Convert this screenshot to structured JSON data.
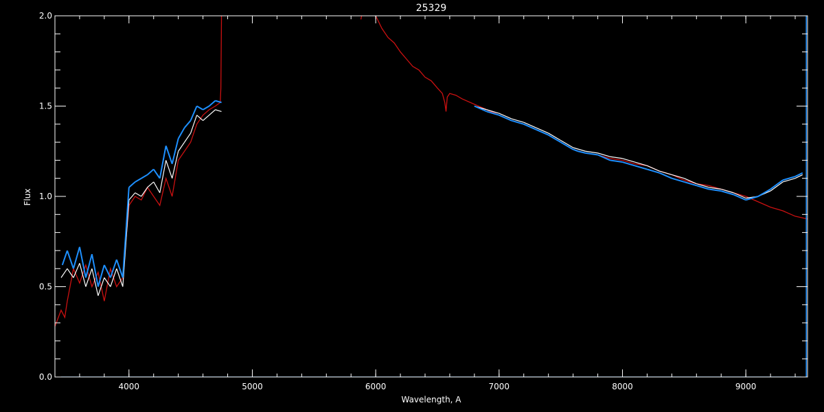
{
  "chart_data": {
    "type": "line",
    "title": "25329",
    "xlabel": "Wavelength, A",
    "ylabel": "Flux",
    "xlim": [
      3400,
      9500
    ],
    "ylim": [
      0,
      2.0
    ],
    "x_ticks": [
      4000,
      5000,
      6000,
      7000,
      8000,
      9000
    ],
    "y_ticks": [
      0.0,
      0.5,
      1.0,
      1.5,
      2.0
    ],
    "x_tick_labels": [
      "4000",
      "5000",
      "6000",
      "7000",
      "8000",
      "9000"
    ],
    "y_tick_labels": [
      "0.0",
      "0.5",
      "1.0",
      "1.5",
      "2.0"
    ],
    "x_minor_step": 200,
    "y_minor_step": 0.1,
    "grid": false,
    "colors": {
      "background": "#000000",
      "axes": "#ffffff",
      "observed_raw": "#ffffff",
      "observed": "#1e90ff",
      "model": "#cc1111"
    },
    "series": [
      {
        "color": "#cc1111",
        "style": "line",
        "x": [
          3400,
          3450,
          3480,
          3500,
          3550,
          3600,
          3650,
          3700,
          3750,
          3800,
          3850,
          3900,
          3950,
          4000,
          4050,
          4100,
          4150,
          4200,
          4250,
          4300,
          4350,
          4400,
          4450,
          4500,
          4550,
          4600,
          4650,
          4700,
          4740,
          4745,
          4750,
          4760
        ],
        "y": [
          0.28,
          0.37,
          0.33,
          0.42,
          0.6,
          0.52,
          0.62,
          0.5,
          0.58,
          0.42,
          0.6,
          0.5,
          0.55,
          0.95,
          1.0,
          0.98,
          1.05,
          1.0,
          0.95,
          1.1,
          1.0,
          1.2,
          1.25,
          1.3,
          1.4,
          1.45,
          1.48,
          1.5,
          1.52,
          1.6,
          2.0,
          2.05
        ]
      },
      {
        "color": "#cc1111",
        "style": "line",
        "x": [
          5880,
          5900,
          5950,
          6000,
          6050,
          6100,
          6150,
          6200,
          6250,
          6300,
          6350,
          6400,
          6450,
          6500,
          6540,
          6560,
          6570,
          6580,
          6600,
          6650,
          6700,
          6800,
          6900,
          7000,
          7100,
          7200,
          7300,
          7400,
          7500,
          7600,
          7700,
          7800,
          7900,
          8000,
          8100,
          8200,
          8300,
          8400,
          8500,
          8600,
          8700,
          8800,
          8900,
          9000,
          9100,
          9200,
          9300,
          9400,
          9500
        ],
        "y": [
          1.98,
          2.05,
          2.05,
          2.0,
          1.93,
          1.88,
          1.85,
          1.8,
          1.76,
          1.72,
          1.7,
          1.66,
          1.64,
          1.6,
          1.57,
          1.52,
          1.47,
          1.55,
          1.57,
          1.56,
          1.54,
          1.51,
          1.48,
          1.45,
          1.42,
          1.4,
          1.37,
          1.34,
          1.3,
          1.26,
          1.24,
          1.23,
          1.21,
          1.2,
          1.18,
          1.17,
          1.14,
          1.12,
          1.09,
          1.07,
          1.06,
          1.04,
          1.02,
          1.0,
          0.97,
          0.94,
          0.92,
          0.89,
          0.875
        ]
      },
      {
        "color": "#ffffff",
        "style": "segments",
        "x": [
          3450,
          3500,
          3550,
          3600,
          3650,
          3700,
          3750,
          3800,
          3850,
          3900,
          3950,
          4000,
          4050,
          4100,
          4150,
          4200,
          4250,
          4300,
          4350,
          4400,
          4450,
          4500,
          4550,
          4600,
          4650,
          4700,
          4750
        ],
        "y": [
          0.55,
          0.6,
          0.55,
          0.63,
          0.5,
          0.6,
          0.45,
          0.55,
          0.5,
          0.6,
          0.5,
          0.98,
          1.02,
          1.0,
          1.05,
          1.08,
          1.02,
          1.2,
          1.1,
          1.25,
          1.3,
          1.35,
          1.45,
          1.42,
          1.45,
          1.48,
          1.47
        ]
      },
      {
        "color": "#ffffff",
        "style": "segments",
        "x": [
          6800,
          6900,
          7000,
          7100,
          7200,
          7300,
          7400,
          7500,
          7600,
          7700,
          7800,
          7900,
          8000,
          8100,
          8200,
          8300,
          8400,
          8500,
          8600,
          8700,
          8800,
          8900,
          9000,
          9100,
          9200,
          9300,
          9400,
          9460
        ],
        "y": [
          1.5,
          1.48,
          1.46,
          1.43,
          1.41,
          1.38,
          1.35,
          1.31,
          1.27,
          1.25,
          1.24,
          1.22,
          1.21,
          1.19,
          1.17,
          1.14,
          1.12,
          1.1,
          1.07,
          1.05,
          1.04,
          1.02,
          0.99,
          1.0,
          1.03,
          1.08,
          1.1,
          1.12
        ]
      },
      {
        "color": "#1e90ff",
        "style": "segments",
        "x": [
          3460,
          3500,
          3550,
          3600,
          3650,
          3700,
          3750,
          3800,
          3850,
          3900,
          3950,
          4000,
          4050,
          4100,
          4150,
          4200,
          4250,
          4300,
          4350,
          4400,
          4450,
          4500,
          4550,
          4600,
          4650,
          4700,
          4750
        ],
        "y": [
          0.62,
          0.7,
          0.6,
          0.72,
          0.55,
          0.68,
          0.5,
          0.62,
          0.55,
          0.65,
          0.55,
          1.05,
          1.08,
          1.1,
          1.12,
          1.15,
          1.1,
          1.28,
          1.18,
          1.32,
          1.38,
          1.42,
          1.5,
          1.48,
          1.5,
          1.53,
          1.52
        ]
      },
      {
        "color": "#1e90ff",
        "style": "segments",
        "x": [
          6800,
          6900,
          7000,
          7100,
          7200,
          7300,
          7400,
          7500,
          7600,
          7640,
          7700,
          7800,
          7900,
          8000,
          8100,
          8200,
          8300,
          8400,
          8500,
          8600,
          8700,
          8800,
          8900,
          9000,
          9100,
          9200,
          9300,
          9400,
          9460
        ],
        "y": [
          1.5,
          1.47,
          1.45,
          1.42,
          1.4,
          1.37,
          1.34,
          1.3,
          1.26,
          1.25,
          1.24,
          1.23,
          1.2,
          1.19,
          1.17,
          1.15,
          1.13,
          1.1,
          1.08,
          1.06,
          1.04,
          1.03,
          1.01,
          0.98,
          1.0,
          1.04,
          1.09,
          1.11,
          1.13
        ]
      },
      {
        "color": "#1e90ff",
        "style": "line",
        "x": [
          3450,
          4750,
          6800,
          9450
        ],
        "y": [
          0.0,
          0.0,
          0.0,
          0.0
        ]
      }
    ],
    "annotations": [
      {
        "x": 9490,
        "y_from": 0.0,
        "y_to": 2.0,
        "color": "#1e90ff"
      }
    ]
  }
}
